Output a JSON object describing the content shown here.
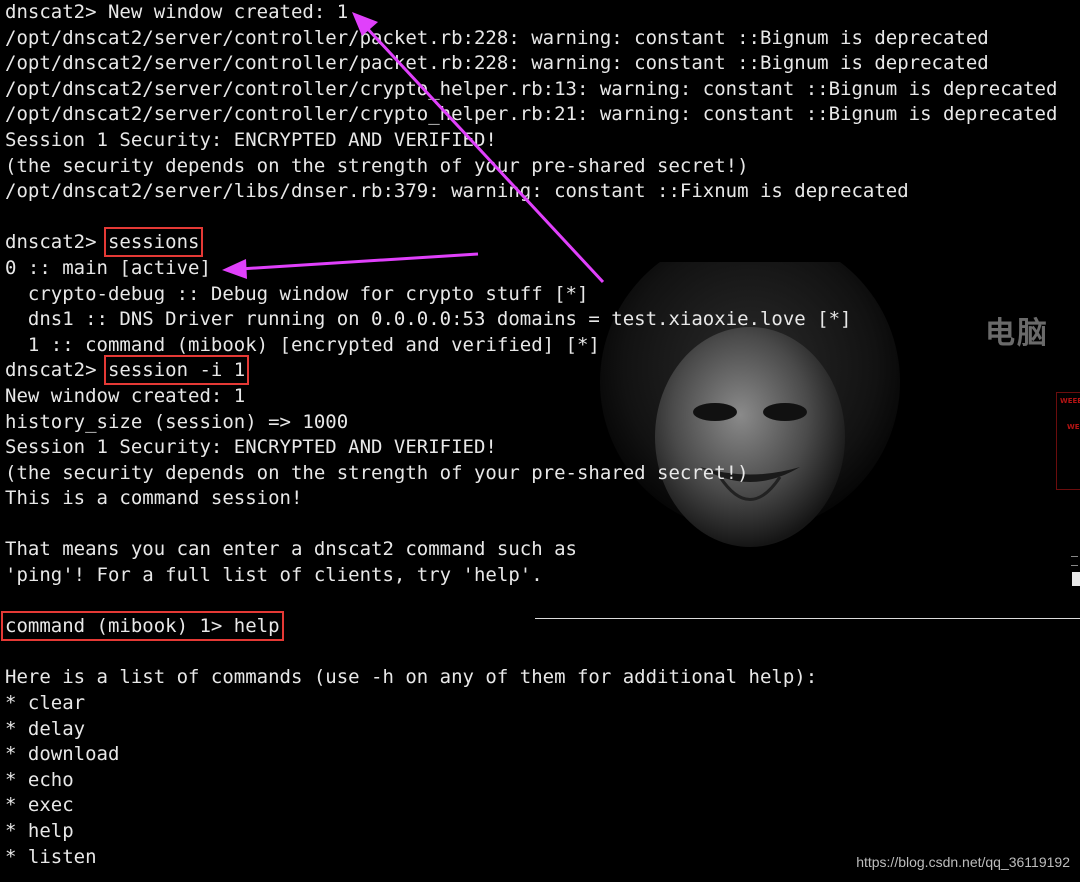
{
  "colors": {
    "background": "#000000",
    "text": "#e8e8e8",
    "highlight_box": "#e53935",
    "arrow": "#e040fb"
  },
  "terminal": {
    "lines": [
      {
        "text": "dnscat2> New window created: 1"
      },
      {
        "text": "/opt/dnscat2/server/controller/packet.rb:228: warning: constant ::Bignum is deprecated"
      },
      {
        "text": "/opt/dnscat2/server/controller/packet.rb:228: warning: constant ::Bignum is deprecated"
      },
      {
        "text": "/opt/dnscat2/server/controller/crypto_helper.rb:13: warning: constant ::Bignum is deprecated"
      },
      {
        "text": "/opt/dnscat2/server/controller/crypto_helper.rb:21: warning: constant ::Bignum is deprecated"
      },
      {
        "text": "Session 1 Security: ENCRYPTED AND VERIFIED!"
      },
      {
        "text": "(the security depends on the strength of your pre-shared secret!)"
      },
      {
        "text": "/opt/dnscat2/server/libs/dnser.rb:379: warning: constant ::Fixnum is deprecated"
      },
      {
        "text": ""
      },
      {
        "prefix": "dnscat2> ",
        "highlight": "sessions"
      },
      {
        "text": "0 :: main [active]"
      },
      {
        "text": "  crypto-debug :: Debug window for crypto stuff [*]"
      },
      {
        "text": "  dns1 :: DNS Driver running on 0.0.0.0:53 domains = test.xiaoxie.love [*]"
      },
      {
        "text": "  1 :: command (mibook) [encrypted and verified] [*]"
      },
      {
        "prefix": "dnscat2> ",
        "highlight": "session -i 1"
      },
      {
        "text": "New window created: 1"
      },
      {
        "text": "history_size (session) => 1000"
      },
      {
        "text": "Session 1 Security: ENCRYPTED AND VERIFIED!"
      },
      {
        "text": "(the security depends on the strength of your pre-shared secret!)"
      },
      {
        "text": "This is a command session!"
      },
      {
        "text": ""
      },
      {
        "text": "That means you can enter a dnscat2 command such as"
      },
      {
        "text": "'ping'! For a full list of clients, try 'help'."
      },
      {
        "text": ""
      },
      {
        "prefix": "",
        "highlight": "command (mibook) 1> help"
      },
      {
        "text": ""
      },
      {
        "text": "Here is a list of commands (use -h on any of them for additional help):"
      },
      {
        "text": "* clear"
      },
      {
        "text": "* delay"
      },
      {
        "text": "* download"
      },
      {
        "text": "* echo"
      },
      {
        "text": "* exec"
      },
      {
        "text": "* help"
      },
      {
        "text": "* listen"
      }
    ]
  },
  "wallpaper": {
    "side_text": "电脑",
    "red_box_line1": "WEEE",
    "red_box_line2": "WE"
  },
  "watermark": "https://blog.csdn.net/qq_36119192"
}
